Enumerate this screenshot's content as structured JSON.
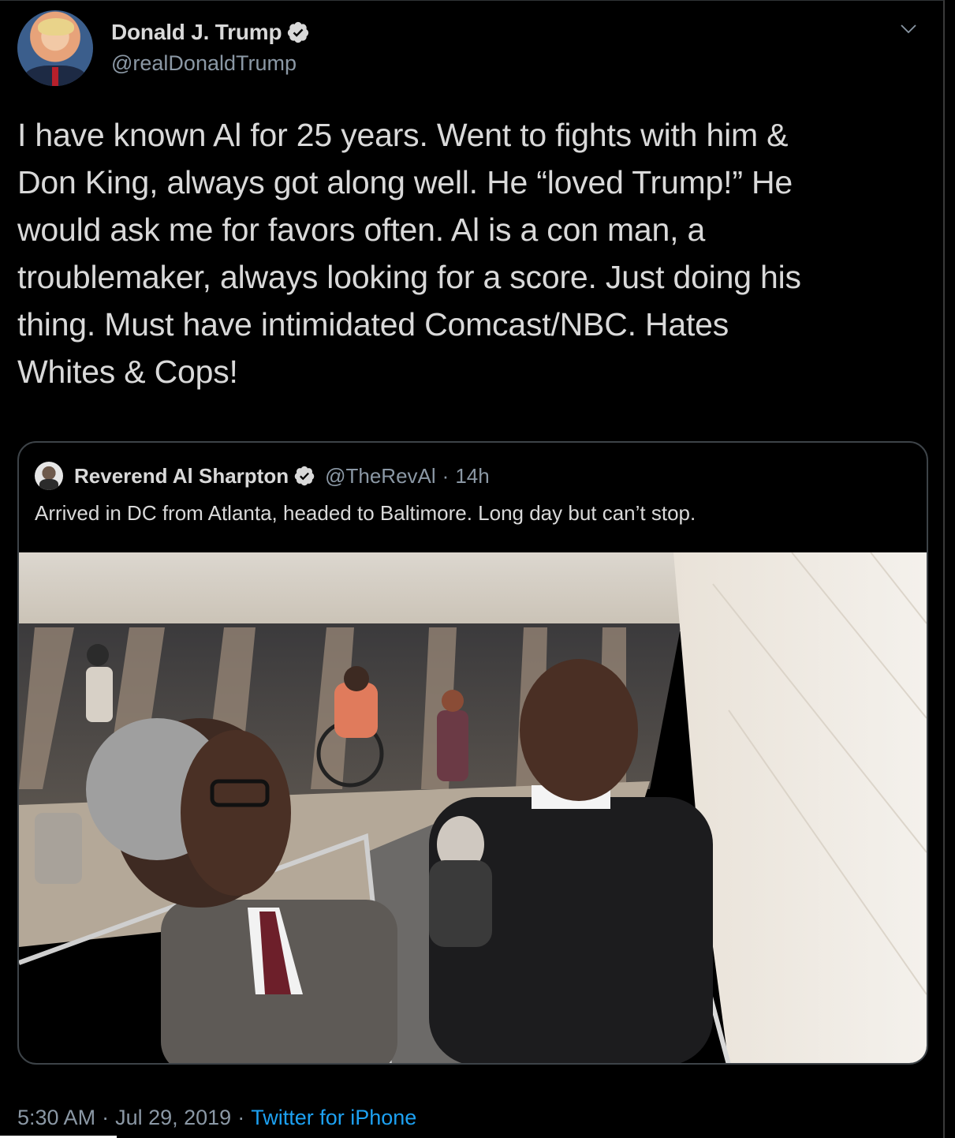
{
  "tweet": {
    "display_name": "Donald J. Trump",
    "handle": "@realDonaldTrump",
    "verified_icon": "verified-badge-icon",
    "avatar_icon": "avatar",
    "more_icon": "chevron-down-icon",
    "text": "I have known Al for 25 years. Went to fights with him &\nDon King, always got along well. He “loved Trump!” He\nwould ask me for favors often. Al is a con man, a\ntroublemaker, always looking for a score. Just doing his\nthing. Must have intimidated Comcast/NBC. Hates\nWhites & Cops!",
    "time": "5:30 AM",
    "date": "Jul 29, 2019",
    "separator": "·",
    "source": "Twitter for iPhone"
  },
  "quoted": {
    "display_name": "Reverend Al Sharpton",
    "handle": "@TheRevAl",
    "separator": "·",
    "age": "14h",
    "text": "Arrived in DC from Atlanta, headed to Baltimore. Long day but can’t stop.",
    "photo": "escalator-photo"
  },
  "colors": {
    "background": "#000000",
    "text": "#d9d9d9",
    "secondary": "#8b98a5",
    "link": "#1da1f2",
    "border": "#3d4348",
    "verified": "#d9d9d9"
  }
}
